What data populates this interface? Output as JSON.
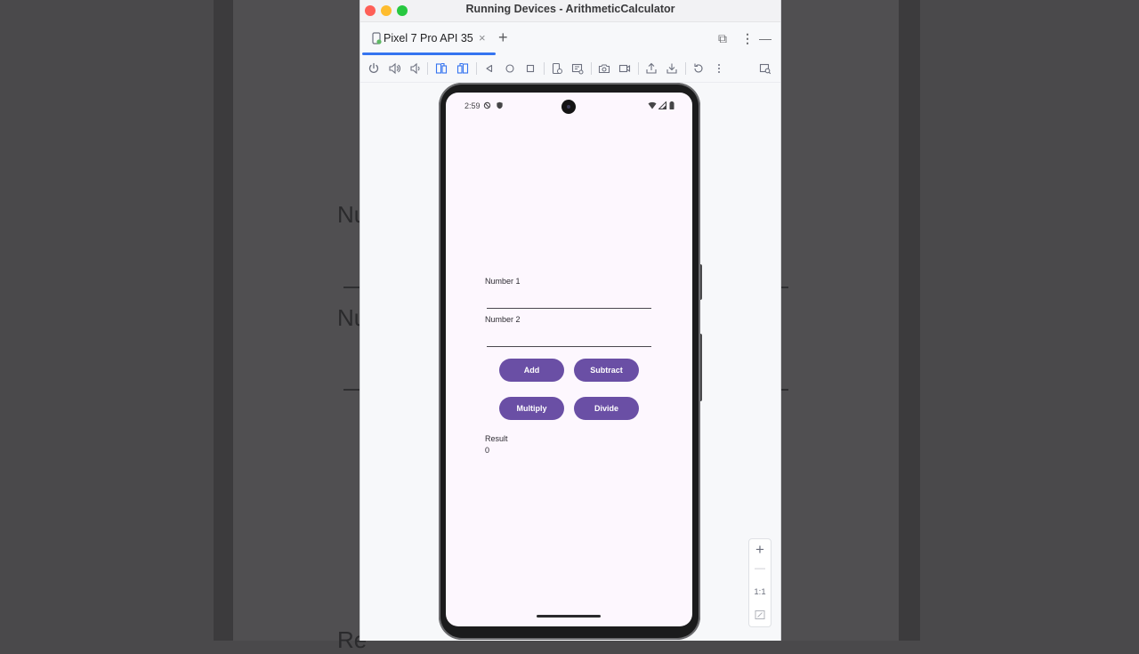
{
  "window": {
    "title": "Running Devices - ArithmeticCalculator"
  },
  "background": {
    "partial_text_1": "Nu",
    "partial_text_2": "Nu",
    "partial_text_3": "Re"
  },
  "tabs": [
    {
      "label": "Pixel 7 Pro API 35",
      "close": "×"
    }
  ],
  "tab_add": "+",
  "tab_actions": {
    "restore": "⧉",
    "more": "⋮",
    "minimize": "—"
  },
  "device": {
    "status_time": "2:59",
    "app": {
      "field1_label": "Number 1",
      "field1_value": "",
      "field2_label": "Number 2",
      "field2_value": "",
      "buttons": {
        "add": "Add",
        "subtract": "Subtract",
        "multiply": "Multiply",
        "divide": "Divide"
      },
      "result_label": "Result",
      "result_value": "0"
    }
  },
  "zoom_controls": {
    "zoom_in": "+",
    "zoom_out": "—",
    "actual_size": "1:1"
  },
  "colors": {
    "accent": "#3574f0",
    "button": "#6a4fa5",
    "app_background": "#fdf7fe"
  }
}
